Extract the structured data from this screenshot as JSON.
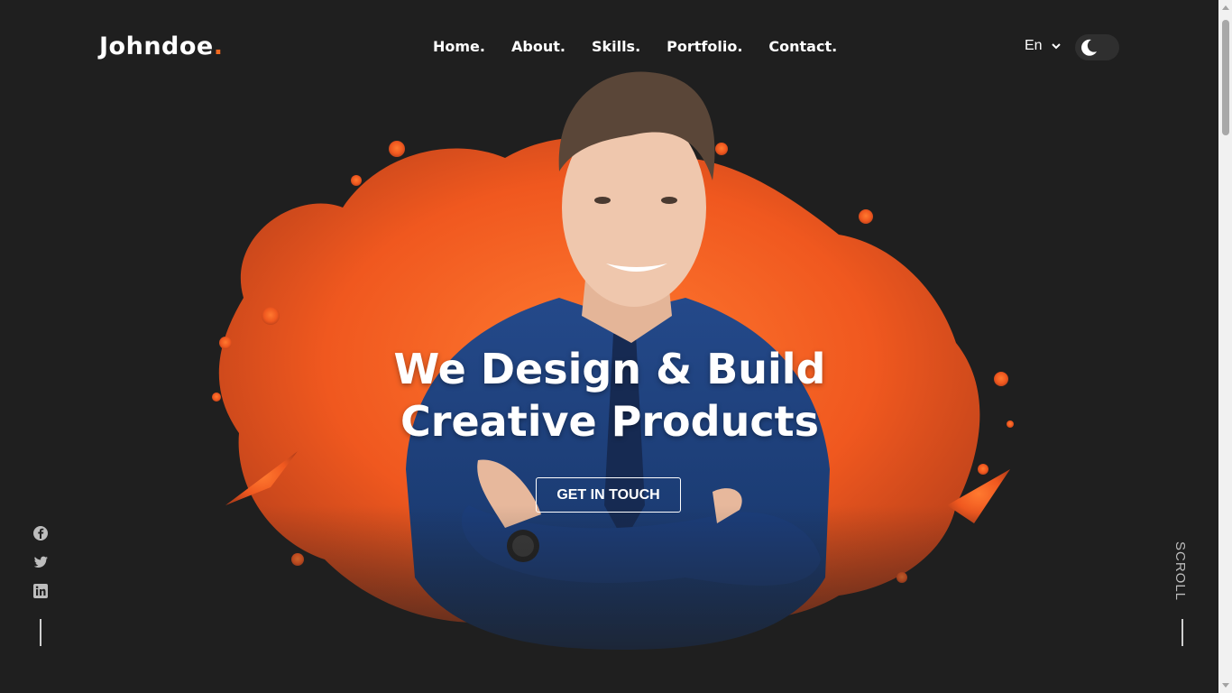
{
  "brand": {
    "name": "Johndoe",
    "dot": ".",
    "accent_color": "#f26a21"
  },
  "nav": {
    "items": [
      {
        "label": "Home."
      },
      {
        "label": "About."
      },
      {
        "label": "Skills."
      },
      {
        "label": "Portfolio."
      },
      {
        "label": "Contact."
      }
    ]
  },
  "language": {
    "selected": "En",
    "icon": "chevron-down-icon"
  },
  "theme_toggle": {
    "mode": "dark",
    "icon": "moon-icon"
  },
  "hero": {
    "headline_line1": "We Design & Build",
    "headline_line2": "Creative Products",
    "cta_label": "GET IN TOUCH",
    "image": "portrait-man-blue-shirt-orange-splash"
  },
  "social": [
    {
      "name": "facebook",
      "icon": "facebook-icon"
    },
    {
      "name": "twitter",
      "icon": "twitter-icon"
    },
    {
      "name": "linkedin",
      "icon": "linkedin-icon"
    }
  ],
  "scroll_label": "SCROLL",
  "colors": {
    "background": "#1f1f1f",
    "splash": "#f26a21",
    "shirt": "#1e3f7a"
  }
}
